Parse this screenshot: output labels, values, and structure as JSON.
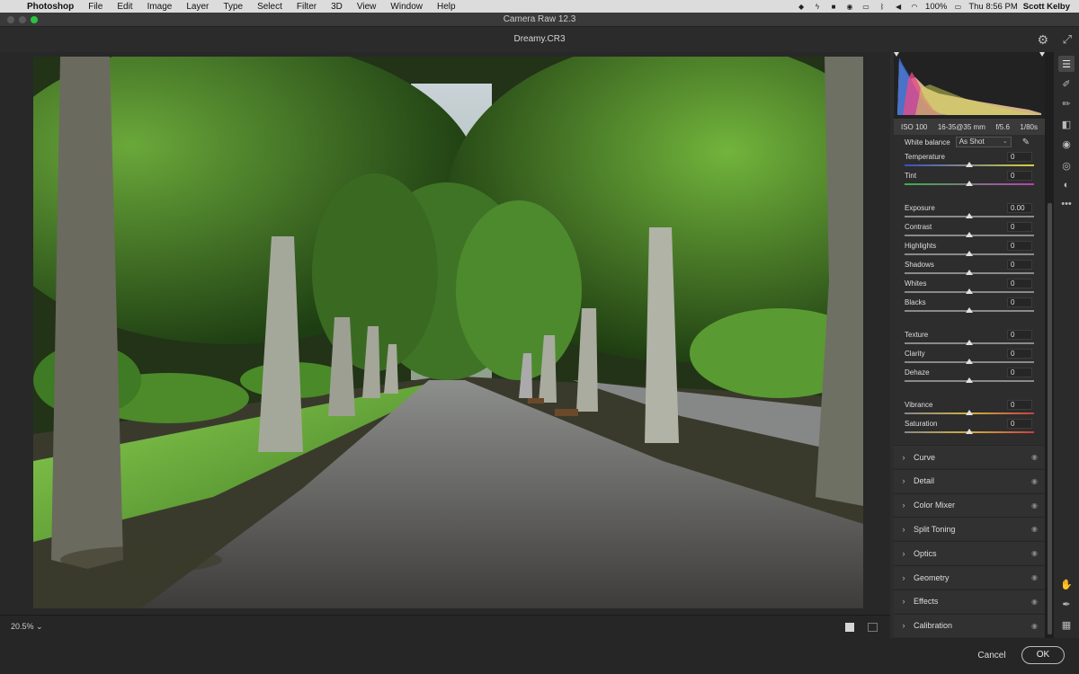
{
  "menubar": {
    "app": "Photoshop",
    "items": [
      "File",
      "Edit",
      "Image",
      "Layer",
      "Type",
      "Select",
      "Filter",
      "3D",
      "View",
      "Window",
      "Help"
    ],
    "battery": "100%",
    "clock": "Thu 8:56 PM",
    "user": "Scott Kelby"
  },
  "window": {
    "title": "Camera Raw 12.3"
  },
  "document": {
    "filename": "Dreamy.CR3"
  },
  "exif": {
    "iso": "ISO 100",
    "lens": "16-35@35 mm",
    "aperture": "f/5.6",
    "shutter": "1/80s"
  },
  "white_balance": {
    "label": "White balance",
    "value": "As Shot"
  },
  "sliders": [
    {
      "label": "Temperature",
      "value": "0",
      "position": 0.5,
      "gradient": "linear-gradient(90deg,#3a4ec8,#d9d13a)"
    },
    {
      "label": "Tint",
      "value": "0",
      "position": 0.5,
      "gradient": "linear-gradient(90deg,#3cb04a,#b840b8)"
    },
    {
      "label": "Exposure",
      "value": "0.00",
      "position": 0.5
    },
    {
      "label": "Contrast",
      "value": "0",
      "position": 0.5
    },
    {
      "label": "Highlights",
      "value": "0",
      "position": 0.5
    },
    {
      "label": "Shadows",
      "value": "0",
      "position": 0.5
    },
    {
      "label": "Whites",
      "value": "0",
      "position": 0.5
    },
    {
      "label": "Blacks",
      "value": "0",
      "position": 0.5
    },
    {
      "label": "Texture",
      "value": "0",
      "position": 0.5
    },
    {
      "label": "Clarity",
      "value": "0",
      "position": 0.5
    },
    {
      "label": "Dehaze",
      "value": "0",
      "position": 0.5
    },
    {
      "label": "Vibrance",
      "value": "0",
      "position": 0.5,
      "gradient": "linear-gradient(90deg,#888,#d0b040,#c84040)"
    },
    {
      "label": "Saturation",
      "value": "0",
      "position": 0.5,
      "gradient": "linear-gradient(90deg,#888,#d0b040,#c84040)"
    }
  ],
  "sections": [
    "Curve",
    "Detail",
    "Color Mixer",
    "Split Toning",
    "Optics",
    "Geometry",
    "Effects",
    "Calibration"
  ],
  "zoom": "20.5%",
  "buttons": {
    "cancel": "Cancel",
    "ok": "OK"
  },
  "tools": [
    "sliders-icon",
    "healing-icon",
    "brush-icon",
    "gradient-icon",
    "radial-icon",
    "redeye-icon",
    "presets-icon",
    "more-icon"
  ],
  "bottom_tools": [
    "hand-icon",
    "sampler-icon",
    "grid-icon"
  ],
  "colors": {
    "panel_bg": "#2d2d2d",
    "accent_ok": "#bbbbbb"
  }
}
